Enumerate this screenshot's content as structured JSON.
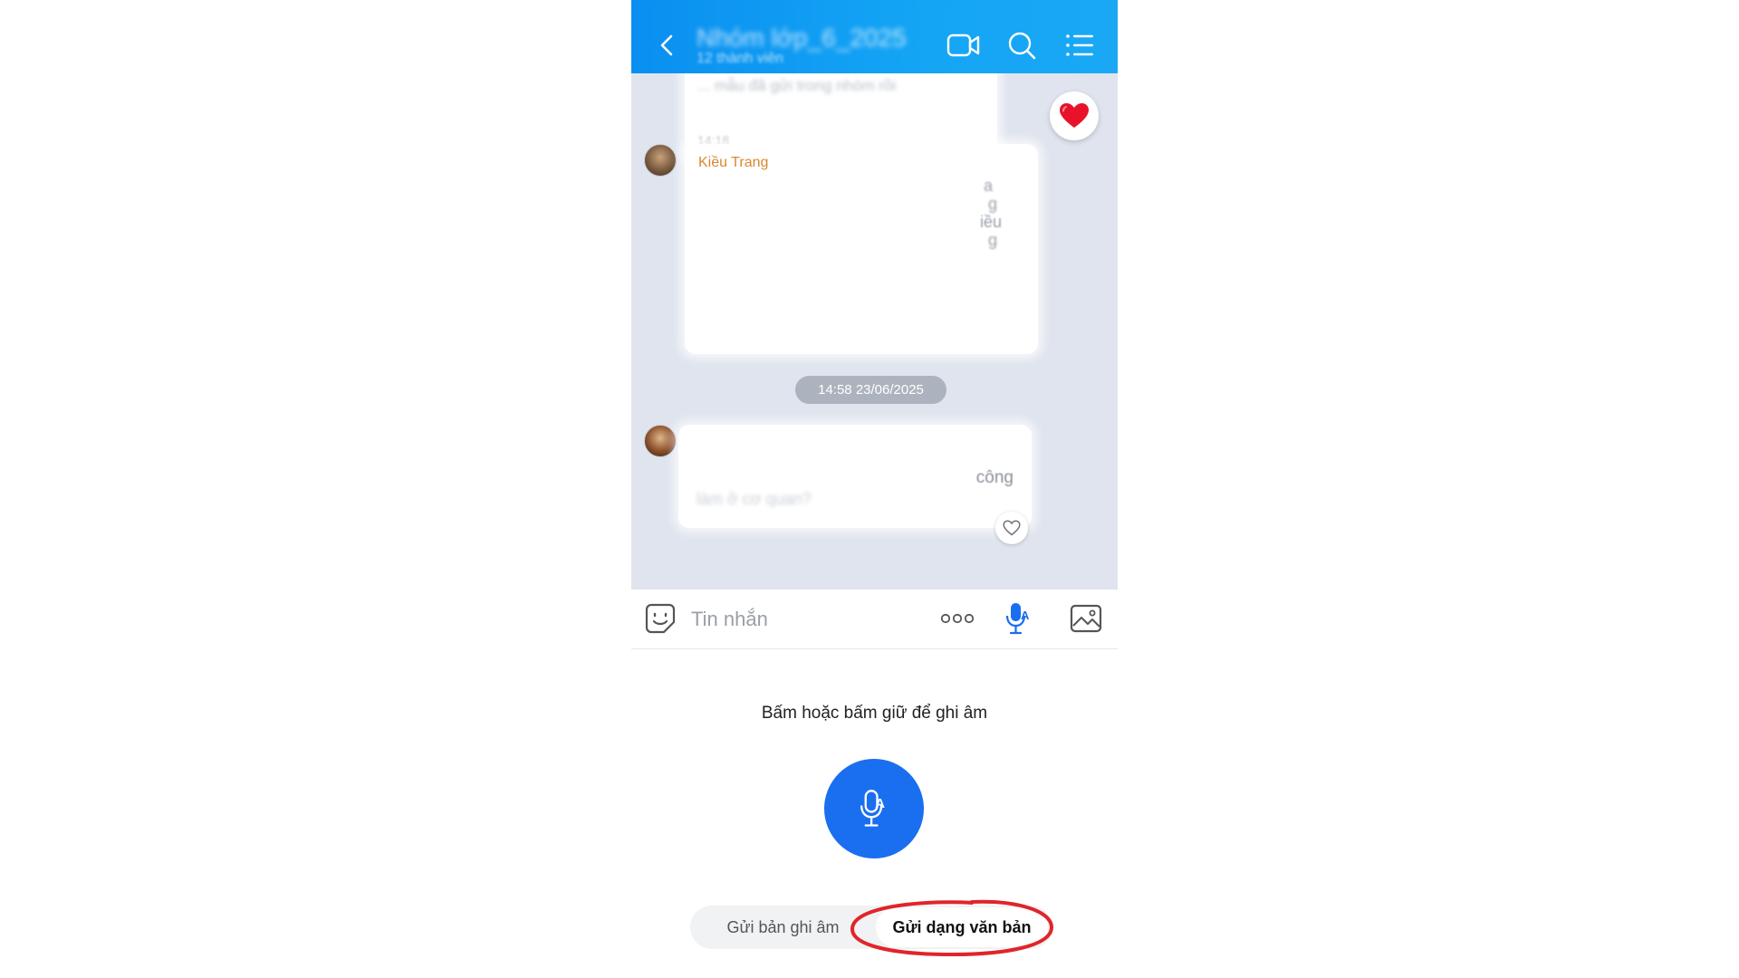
{
  "header": {
    "title": "Nhóm lớp_6_2025",
    "subtitle": "12 thành viên"
  },
  "messages": {
    "top_preview": "... mẫu đã gửi trong nhóm rồi",
    "top_time": "14:18",
    "sender_name": "Kiều Trang",
    "kieu_fragments": [
      "a",
      "g",
      "iều",
      "g"
    ],
    "time_separator": "14:58 23/06/2025",
    "second_fragment": "công",
    "second_line": "làm ở cơ quan?"
  },
  "input": {
    "placeholder": "Tin nhắn"
  },
  "recorder": {
    "hint": "Bấm hoặc bấm giữ để ghi âm",
    "mode_audio": "Gửi bản ghi âm",
    "mode_text": "Gửi dạng văn bản"
  },
  "colors": {
    "header": "#0a8ff0",
    "accent": "#1a6ef0",
    "sender_name": "#d9882e",
    "highlight": "#e0252b"
  }
}
